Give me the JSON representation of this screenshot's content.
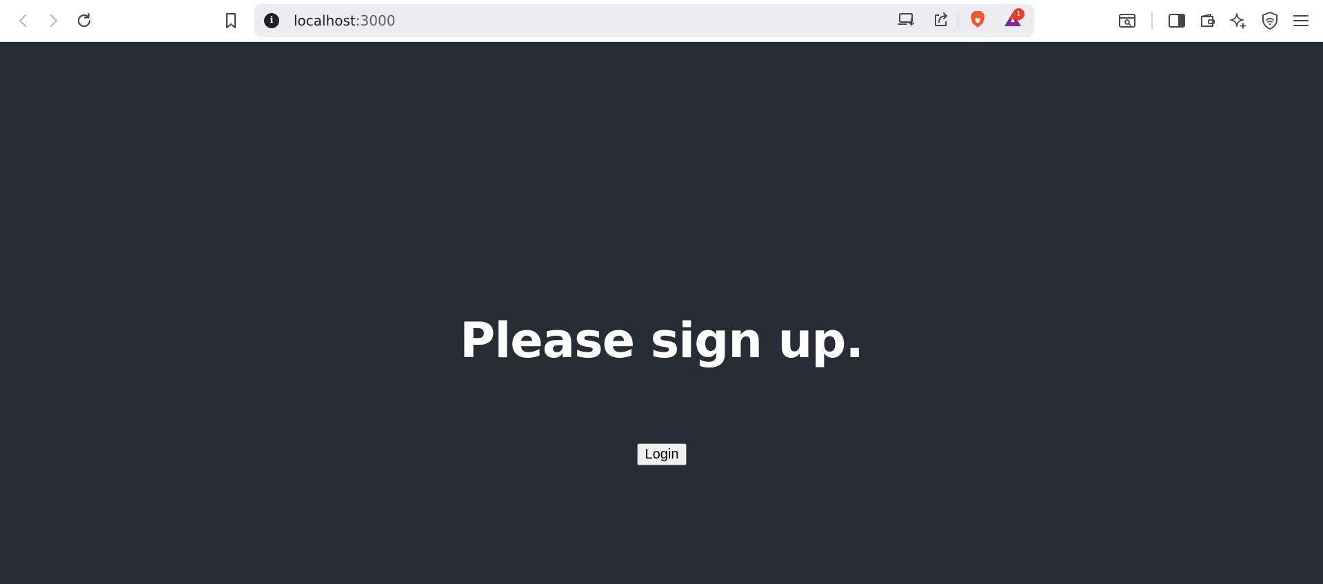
{
  "browser": {
    "url_host": "localhost",
    "url_port": ":3000",
    "rewards_badge_count": "1",
    "icons": {
      "back": "back-arrow-icon",
      "forward": "forward-arrow-icon",
      "reload": "reload-icon",
      "bookmark": "bookmark-icon",
      "site_info": "info-icon",
      "install": "install-app-icon",
      "share": "share-icon",
      "shields": "brave-lion-icon",
      "rewards": "bat-triangle-icon",
      "screenshot": "tab-search-icon",
      "sidebar": "sidebar-icon",
      "wallet": "wallet-icon",
      "leo": "leo-ai-icon",
      "vpn": "vpn-shield-icon",
      "menu": "hamburger-menu-icon"
    },
    "colors": {
      "brave_orange": "#fb542b",
      "rewards_purple": "#6b2ca3",
      "badge_red": "#ee3b2a"
    }
  },
  "page": {
    "background": "#282c34",
    "heading": "Please sign up.",
    "login_button": "Login"
  }
}
